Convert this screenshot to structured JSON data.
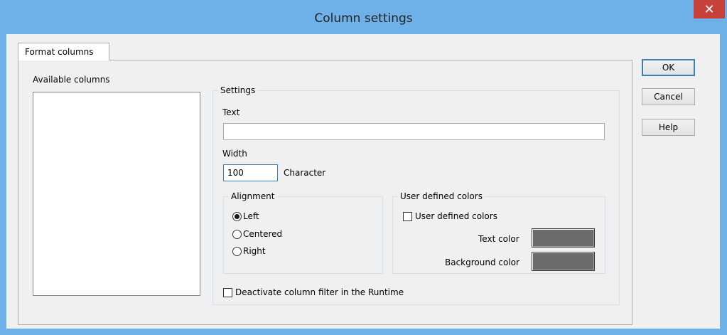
{
  "window": {
    "title": "Column settings",
    "close_glyph": "✕"
  },
  "tabs": [
    {
      "label": "Format columns",
      "active": true
    }
  ],
  "available_columns": {
    "label": "Available columns",
    "items": []
  },
  "settings": {
    "caption": "Settings",
    "text_label": "Text",
    "text_value": "",
    "width_label": "Width",
    "width_value": "100",
    "width_unit": "Character",
    "alignment": {
      "caption": "Alignment",
      "options": [
        "Left",
        "Centered",
        "Right"
      ],
      "selected": "Left"
    },
    "user_colors": {
      "caption": "User defined colors",
      "checkbox_label": "User defined colors",
      "checked": false,
      "text_color_label": "Text color",
      "text_color": "#6b6b6b",
      "background_color_label": "Background color",
      "background_color": "#6b6b6b"
    },
    "deactivate_filter_label": "Deactivate column filter in the Runtime",
    "deactivate_filter_checked": false
  },
  "buttons": {
    "ok": "OK",
    "cancel": "Cancel",
    "help": "Help"
  },
  "colors": {
    "titlebar": "#6eb1e8",
    "close": "#c7413a",
    "face": "#f0f0f0"
  }
}
